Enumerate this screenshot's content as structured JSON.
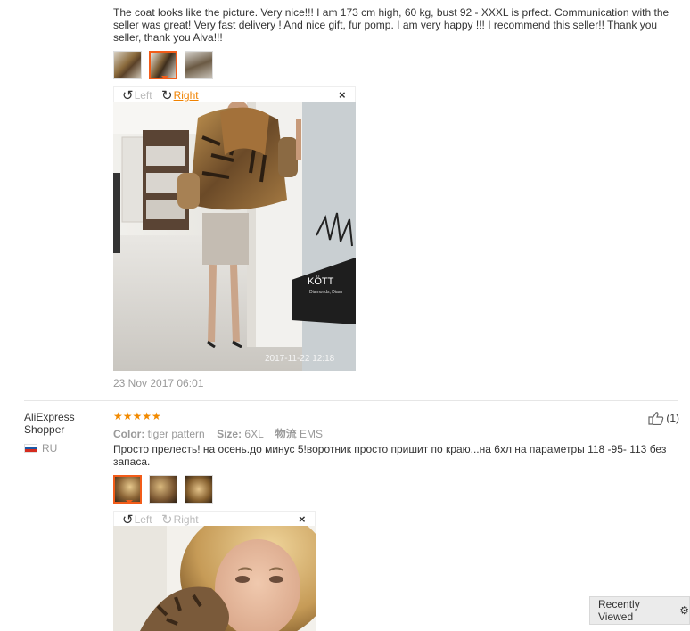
{
  "review1": {
    "text": "The coat looks like the picture. Very nice!!! I am 173 cm high, 60 kg, bust 92 - XXXL is prfect. Communication with the seller was great! Very fast delivery ! And nice gift, fur pomp. I am very happy !!! I recommend this seller!! Thank you seller, thank you Alva!!!",
    "viewer": {
      "left_label": "Left",
      "right_label": "Right",
      "close_label": "×"
    },
    "photo_timestamp": "2017-11-22 12:18",
    "photo_sign": "KÖTT",
    "photo_sign_sub": "Diamonds, Diam",
    "date": "23 Nov 2017 06:01"
  },
  "review2": {
    "user": "AliExpress Shopper",
    "country": "RU",
    "stars": "★★★★★",
    "color_label": "Color:",
    "color_value": "tiger pattern",
    "size_label": "Size:",
    "size_value": "6XL",
    "logistics_label": "物流",
    "logistics_value": "EMS",
    "helpful_count": "(1)",
    "text": "Просто прелесть! на осень.до минус 5!воротник просто пришит по краю...на 6хл на параметры 118 -95- 113 без запаса.",
    "viewer": {
      "left_label": "Left",
      "right_label": "Right",
      "close_label": "×"
    }
  },
  "recently_viewed": {
    "label": "Recently Viewed"
  },
  "colors": {
    "accent": "#f25c19",
    "link": "#f08200",
    "star": "#f28a00"
  }
}
